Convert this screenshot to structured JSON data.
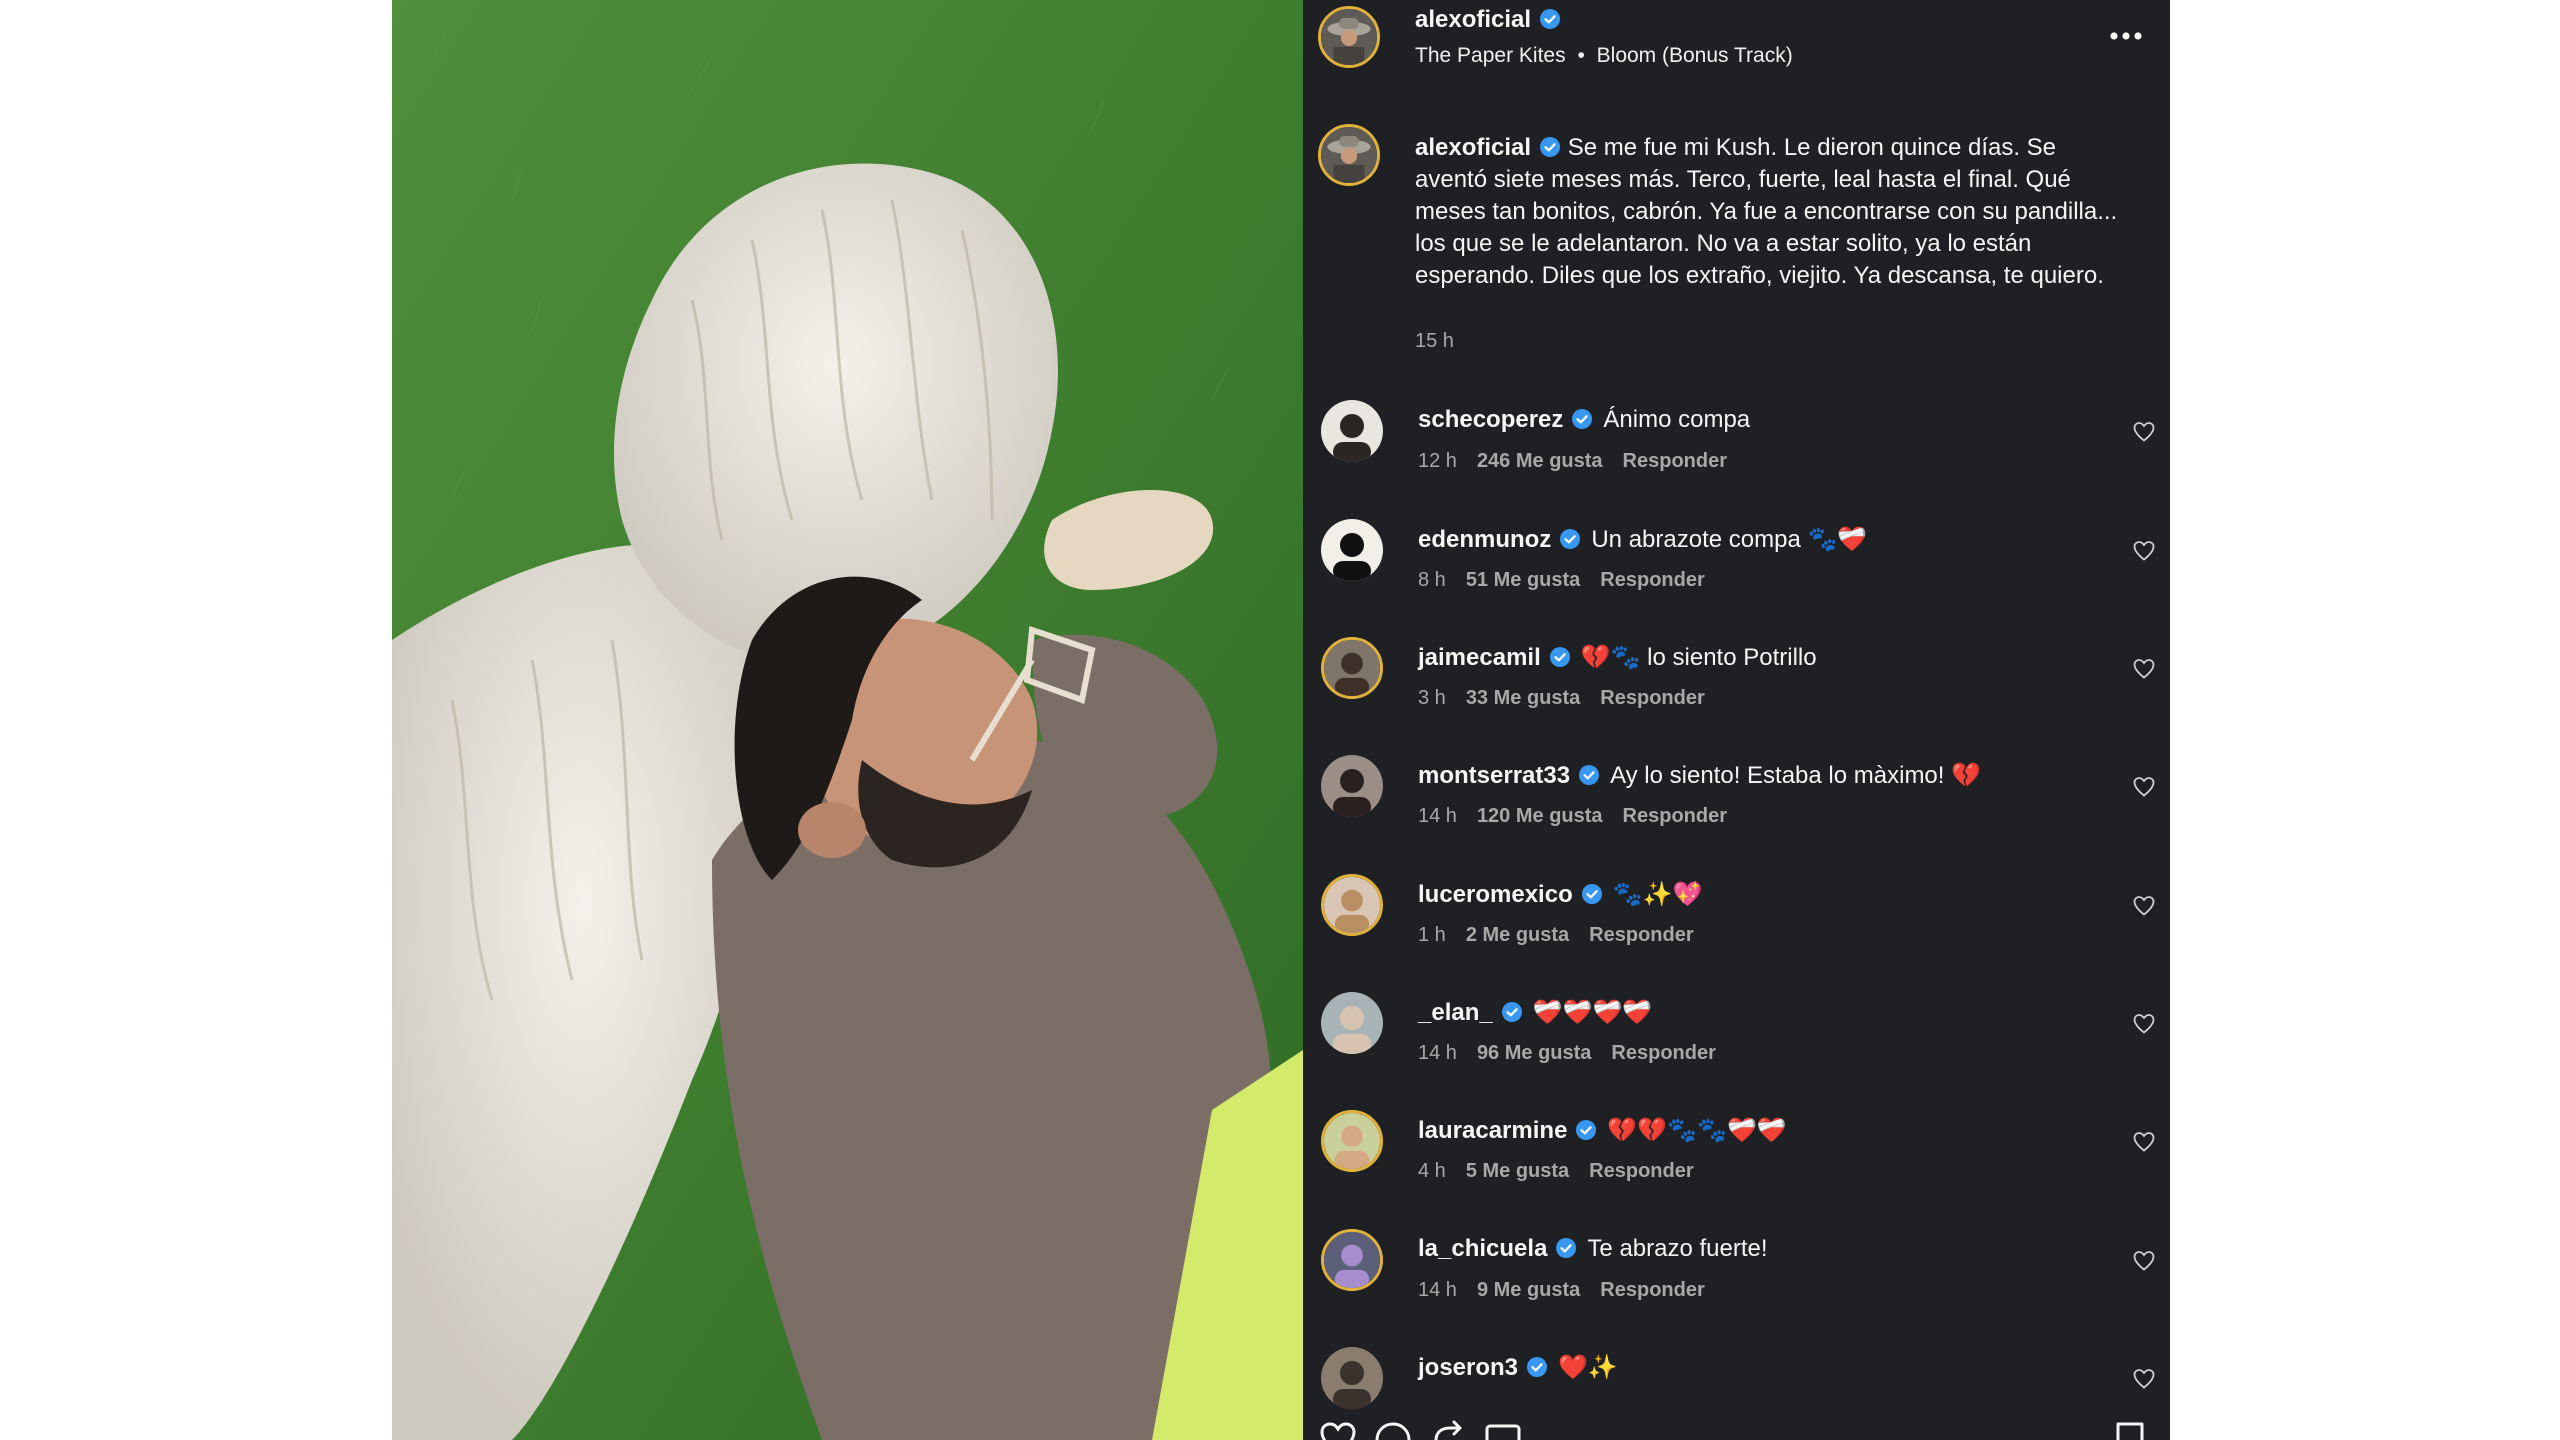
{
  "colors": {
    "panel_bg": "#1f2023",
    "text": "#f5f5f5",
    "muted": "#a8a8a8",
    "verified": "#3897f0",
    "story_ring": "#e0b23c"
  },
  "post": {
    "username": "alexoficial",
    "music": {
      "artist": "The Paper Kites",
      "separator": "•",
      "track": "Bloom (Bonus Track)"
    },
    "more_icon": "more-horizontal-icon",
    "caption": {
      "username": "alexoficial",
      "text": "Se me fue mi Kush. Le dieron quince días. Se aventó siete meses más. Terco, fuerte, leal hasta el final. Qué meses tan bonitos, cabrón. Ya fue a encontrarse con su pandilla... los que se le adelantaron. No va a estar solito, ya lo están esperando. Diles que los extraño, viejito. Ya descansa, te quiero.",
      "time": "15 h"
    }
  },
  "comments": [
    {
      "username": "schecoperez",
      "text": "Ánimo compa",
      "time": "12 h",
      "likes": "246 Me gusta",
      "reply": "Responder"
    },
    {
      "username": "edenmunoz",
      "text": "Un abrazote compa 🐾❤️‍🩹",
      "time": "8 h",
      "likes": "51 Me gusta",
      "reply": "Responder"
    },
    {
      "username": "jaimecamil",
      "text": "💔🐾 lo siento Potrillo",
      "time": "3 h",
      "likes": "33 Me gusta",
      "reply": "Responder"
    },
    {
      "username": "montserrat33",
      "text": "Ay lo siento! Estaba lo màximo! 💔",
      "time": "14 h",
      "likes": "120 Me gusta",
      "reply": "Responder"
    },
    {
      "username": "luceromexico",
      "text": "🐾✨💖",
      "time": "1 h",
      "likes": "2 Me gusta",
      "reply": "Responder"
    },
    {
      "username": "_elan_",
      "text": "❤️‍🩹❤️‍🩹❤️‍🩹❤️‍🩹",
      "time": "14 h",
      "likes": "96 Me gusta",
      "reply": "Responder"
    },
    {
      "username": "lauracarmine",
      "text": "💔💔🐾🐾❤️‍🩹❤️‍🩹",
      "time": "4 h",
      "likes": "5 Me gusta",
      "reply": "Responder"
    },
    {
      "username": "la_chicuela",
      "text": "Te abrazo fuerte!",
      "time": "14 h",
      "likes": "9 Me gusta",
      "reply": "Responder"
    },
    {
      "username": "joseron3",
      "text": "❤️✨",
      "time": "",
      "likes": "",
      "reply": ""
    }
  ],
  "action_icons": [
    "heart-icon",
    "comment-icon",
    "share-icon",
    "send-icon",
    "bookmark-icon"
  ]
}
